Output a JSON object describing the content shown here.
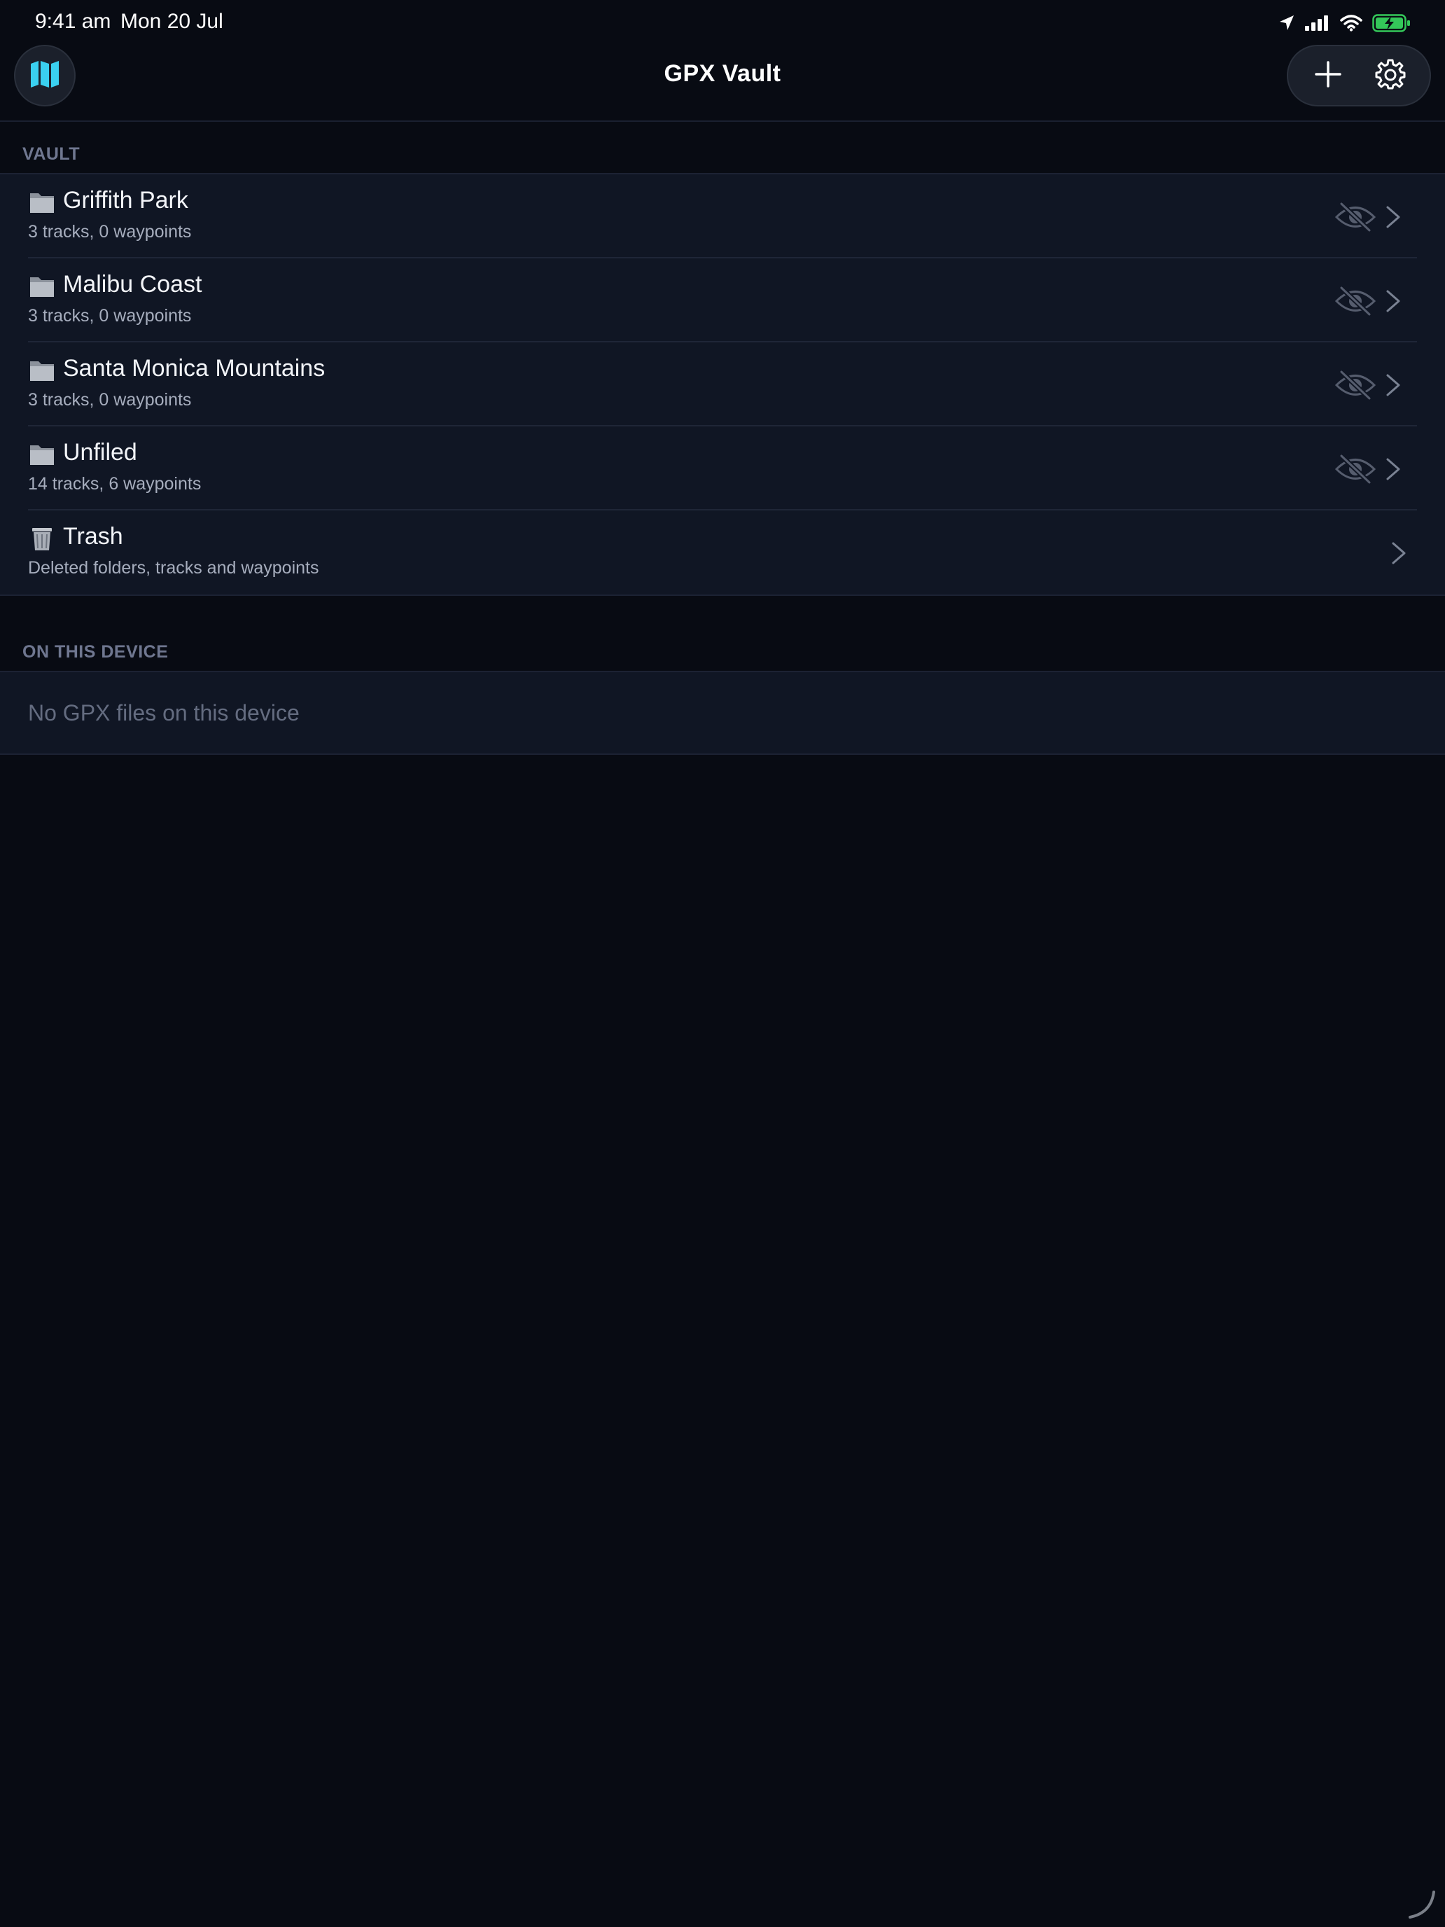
{
  "status_bar": {
    "time": "9:41 am",
    "date": "Mon 20 Jul",
    "icons": [
      "location-arrow-icon",
      "cellular-signal-icon",
      "wifi-icon",
      "battery-charging-icon"
    ],
    "battery_color": "#34c759"
  },
  "nav": {
    "title": "GPX Vault",
    "left_button_icon": "map-icon",
    "right_buttons": [
      "plus-icon",
      "gear-icon"
    ],
    "accent_color": "#3ad0f0"
  },
  "vault": {
    "header": "VAULT",
    "folders": [
      {
        "title": "Griffith Park",
        "subtitle": "3 tracks, 0 waypoints",
        "icon": "folder-icon",
        "visibility_icon": "eye-slash-icon"
      },
      {
        "title": "Malibu Coast",
        "subtitle": "3 tracks, 0 waypoints",
        "icon": "folder-icon",
        "visibility_icon": "eye-slash-icon"
      },
      {
        "title": "Santa Monica Mountains",
        "subtitle": "3 tracks, 0 waypoints",
        "icon": "folder-icon",
        "visibility_icon": "eye-slash-icon"
      },
      {
        "title": "Unfiled",
        "subtitle": "14 tracks, 6 waypoints",
        "icon": "folder-icon",
        "visibility_icon": "eye-slash-icon"
      }
    ],
    "trash": {
      "title": "Trash",
      "subtitle": "Deleted folders, tracks and waypoints",
      "icon": "trash-can-icon"
    }
  },
  "device": {
    "header": "ON THIS DEVICE",
    "empty_message": "No GPX files on this device"
  }
}
